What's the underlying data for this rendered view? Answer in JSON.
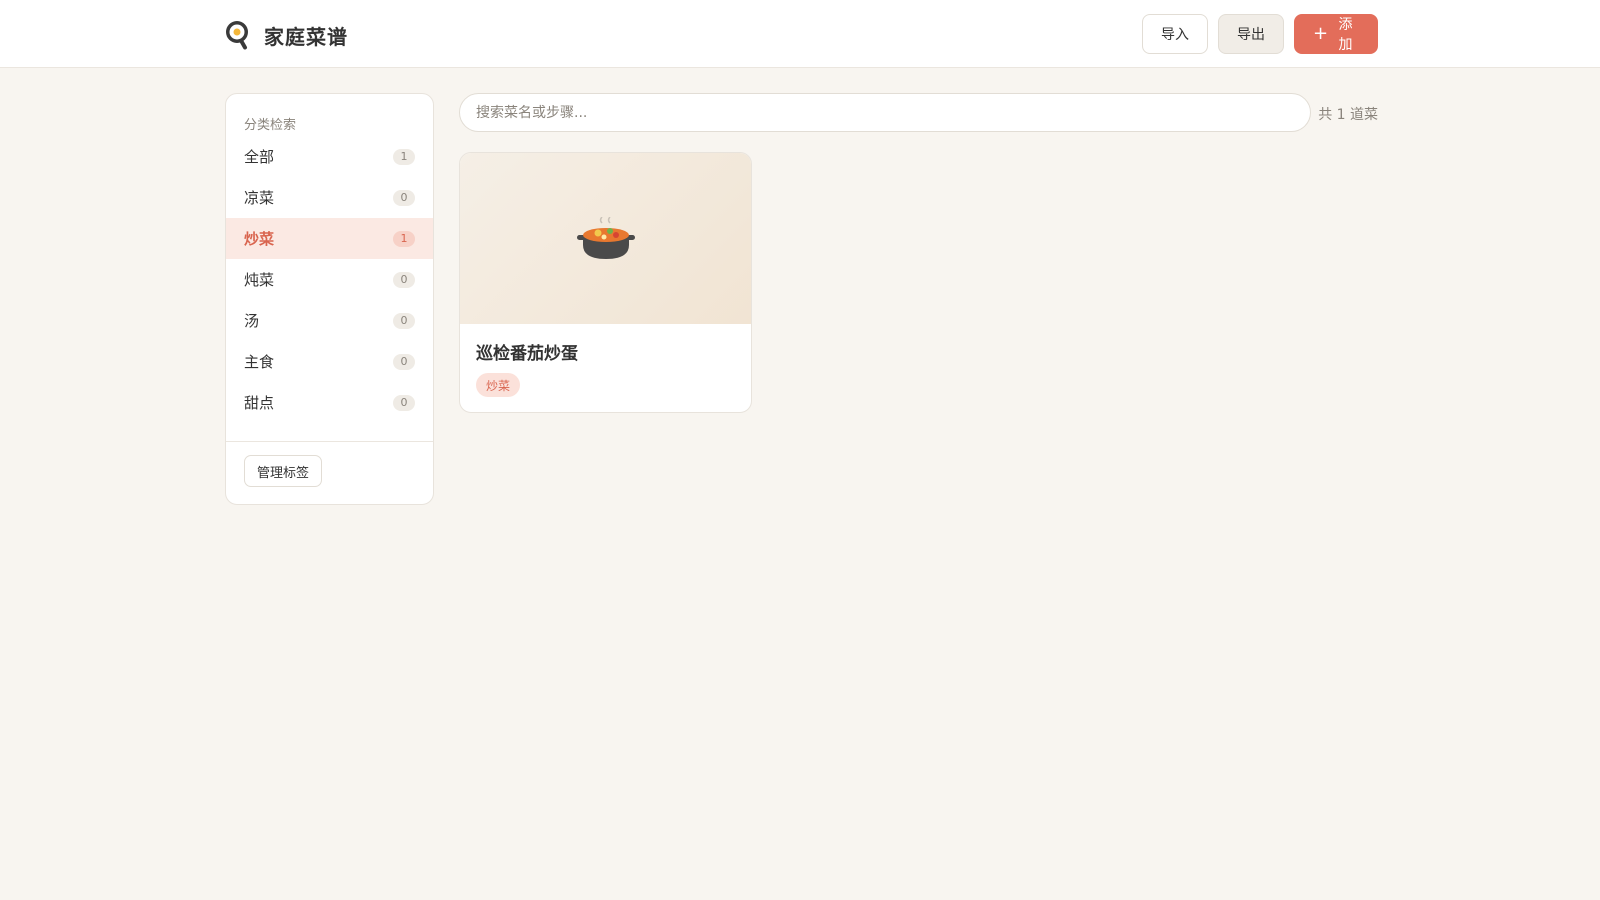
{
  "header": {
    "logo_icon": "frying-pan-egg-icon",
    "title": "家庭菜谱",
    "import_label": "导入",
    "export_label": "导出",
    "add_icon": "plus-icon",
    "add_label": "添加"
  },
  "sidebar": {
    "heading": "分类检索",
    "categories": [
      {
        "label": "全部",
        "count": "1"
      },
      {
        "label": "凉菜",
        "count": "0"
      },
      {
        "label": "炒菜",
        "count": "1",
        "active": true
      },
      {
        "label": "炖菜",
        "count": "0"
      },
      {
        "label": "汤",
        "count": "0"
      },
      {
        "label": "主食",
        "count": "0"
      },
      {
        "label": "甜点",
        "count": "0"
      }
    ],
    "manage_label": "管理标签"
  },
  "search": {
    "placeholder": "搜索菜名或步骤...",
    "value": ""
  },
  "results": {
    "total_text": "共 1 道菜"
  },
  "recipes": [
    {
      "title": "巡检番茄炒蛋",
      "tag": "炒菜",
      "image_icon": "stew-pot-icon"
    }
  ],
  "colors": {
    "accent": "#e36d5a",
    "background": "#f8f5f0",
    "active_bg": "#fbe9e3"
  }
}
